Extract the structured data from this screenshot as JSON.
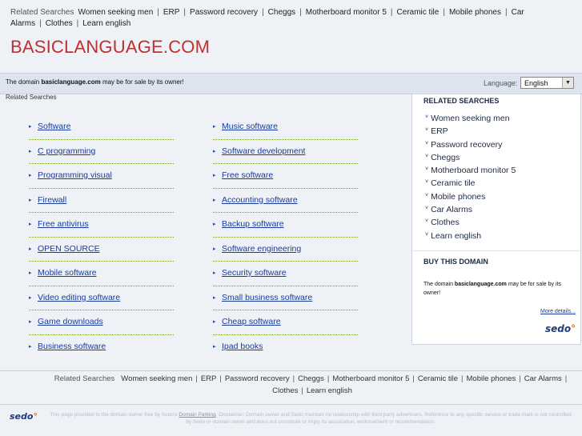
{
  "top": {
    "lead": "Related Searches",
    "links": [
      "Women seeking men",
      "ERP",
      "Password recovery",
      "Cheggs",
      "Motherboard monitor 5",
      "Ceramic tile",
      "Mobile phones",
      "Car Alarms",
      "Clothes",
      "Learn english"
    ]
  },
  "site_title": "BASICLANGUAGE.COM",
  "sale_bar": {
    "prefix": "The domain ",
    "domain": "basiclanguage.com",
    "suffix": " may be for sale by its owner!",
    "language_label": "Language:",
    "language_value": "English"
  },
  "related_heading": "Related Searches",
  "left_links": [
    "Software",
    "C programming",
    "Programming visual",
    "Firewall",
    "Free antivirus",
    "OPEN SOURCE",
    "Mobile software",
    "Video editing software",
    "Game downloads",
    "Business software"
  ],
  "right_links": [
    "Music software",
    "Software development",
    "Free software",
    "Accounting software",
    "Backup software",
    "Software engineering",
    "Security software",
    "Small business software",
    "Cheap software",
    "Ipad books"
  ],
  "side": {
    "heading": "RELATED SEARCHES",
    "items": [
      "Women seeking men",
      "ERP",
      "Password recovery",
      "Cheggs",
      "Motherboard monitor 5",
      "Ceramic tile",
      "Mobile phones",
      "Car Alarms",
      "Clothes",
      "Learn english"
    ],
    "buy_heading": "BUY THIS DOMAIN",
    "buy_prefix": "The domain ",
    "buy_domain": "basiclanguage.com",
    "buy_suffix": " may be for sale by its owner!",
    "more": "More details...",
    "logo": "sedo"
  },
  "bottom": {
    "lead": "Related Searches",
    "links": [
      "Women seeking men",
      "ERP",
      "Password recovery",
      "Cheggs",
      "Motherboard monitor 5",
      "Ceramic tile",
      "Mobile phones",
      "Car Alarms",
      "Clothes",
      "Learn english"
    ]
  },
  "footer": {
    "logo": "sedo",
    "text_before": "This page provided to the domain owner free by Sedo's ",
    "link": "Domain Parking",
    "text_after": ". Disclaimer: Domain owner and Sedo maintain no relationship with third party advertisers. Reference to any specific service or trade mark is not controlled by Sedo or domain owner and does not constitute or imply its association, endorsement or recommendation."
  },
  "colors": {
    "title": "#c0302f",
    "link": "#1a3b9c",
    "rule": "#7aa03a",
    "bar": "#dde4f0"
  }
}
